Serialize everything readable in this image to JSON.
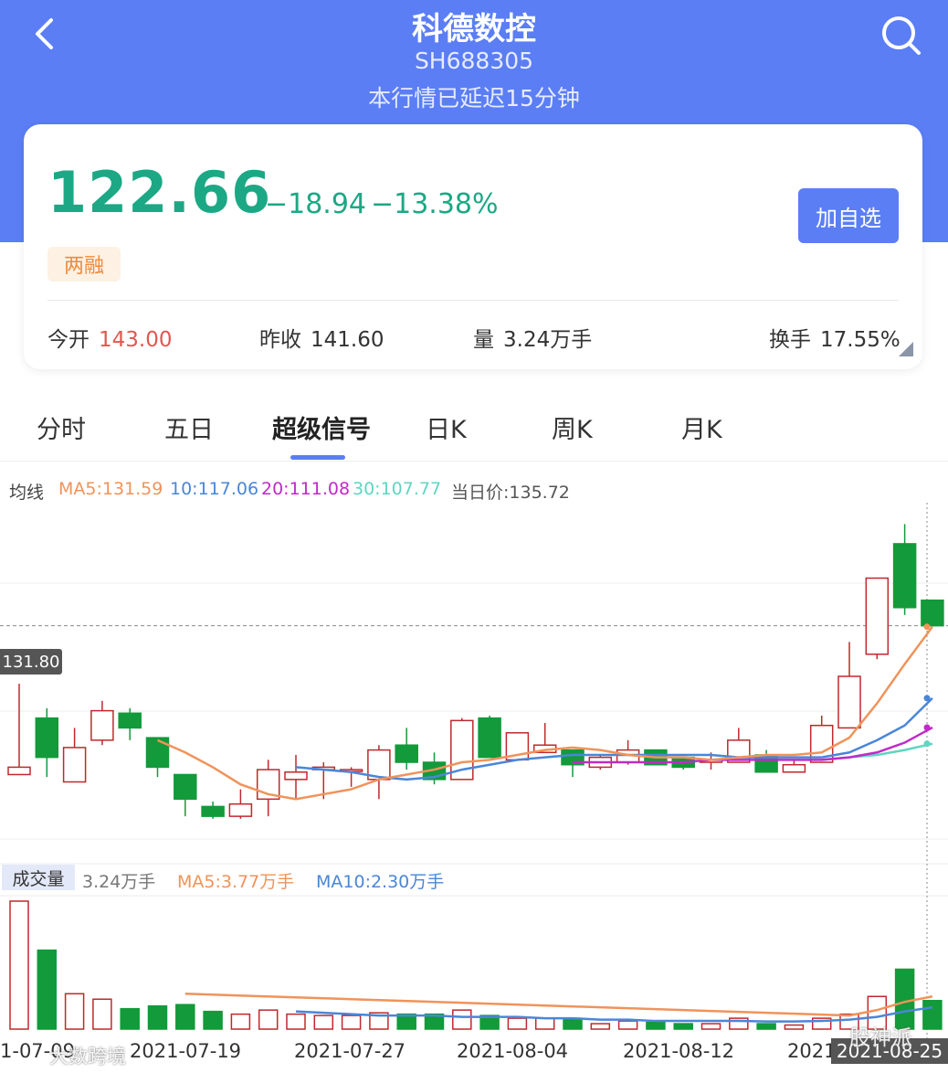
{
  "header": {
    "title": "科德数控",
    "code": "SH688305",
    "delay_notice": "本行情已延迟15分钟"
  },
  "quote": {
    "price": "122.66",
    "change": "−18.94",
    "change_pct": "−13.38%",
    "tag": "两融",
    "add_button": "加自选",
    "stats": [
      {
        "label": "今开",
        "value": "143.00"
      },
      {
        "label": "昨收",
        "value": "141.60"
      },
      {
        "label": "量",
        "value": "3.24万手"
      },
      {
        "label": "换手",
        "value": "17.55%"
      }
    ]
  },
  "tabs": [
    "分时",
    "五日",
    "超级信号",
    "日K",
    "周K",
    "月K"
  ],
  "active_tab": "超级信号",
  "ma_legend": {
    "label": "均线",
    "ma5": "MA5:131.59",
    "ma10": "10:117.06",
    "ma20": "20:111.08",
    "ma30": "30:107.77",
    "day_price": "当日价:135.72"
  },
  "price_marker": "131.80",
  "volume_legend": {
    "label": "成交量",
    "vol": "3.24万手",
    "ma5": "MA5:3.77万手",
    "ma10": "MA10:2.30万手"
  },
  "dates": [
    "1-07-09",
    "2021-07-19",
    "2021-07-27",
    "2021-08-04",
    "2021-08-12",
    "2021",
    "2021-08-25"
  ],
  "watermarks": [
    "大数跨境",
    "股神派"
  ],
  "colors": {
    "brand": "#5b7ef5",
    "down": "#1ca884",
    "up": "#c0282d",
    "ma5": "#f0935a",
    "ma10": "#4a86d8",
    "ma20": "#c02ac8",
    "ma30": "#5fd6c0"
  },
  "chart_data": {
    "type": "candlestick",
    "candles": [
      {
        "o": 101.5,
        "c": 103.0,
        "h": 120.0,
        "l": 101.5
      },
      {
        "o": 113.0,
        "c": 105.0,
        "h": 115.0,
        "l": 101.0
      },
      {
        "o": 100.0,
        "c": 107.0,
        "h": 111.0,
        "l": 100.0
      },
      {
        "o": 108.5,
        "c": 114.5,
        "h": 116.5,
        "l": 107.5
      },
      {
        "o": 114.0,
        "c": 111.0,
        "h": 115.0,
        "l": 108.5
      },
      {
        "o": 109.0,
        "c": 103.0,
        "h": 109.0,
        "l": 101.0
      },
      {
        "o": 101.5,
        "c": 96.5,
        "h": 101.5,
        "l": 93.0
      },
      {
        "o": 95.0,
        "c": 93.0,
        "h": 96.0,
        "l": 92.5
      },
      {
        "o": 93.0,
        "c": 95.5,
        "h": 98.5,
        "l": 92.5
      },
      {
        "o": 96.5,
        "c": 102.5,
        "h": 104.5,
        "l": 93.0
      },
      {
        "o": 100.5,
        "c": 102.0,
        "h": 105.5,
        "l": 96.5
      },
      {
        "o": 102.5,
        "c": 103.0,
        "h": 104.0,
        "l": 96.5
      },
      {
        "o": 102.5,
        "c": 102.5,
        "h": 103.0,
        "l": 99.0
      },
      {
        "o": 100.5,
        "c": 106.5,
        "h": 107.5,
        "l": 96.5
      },
      {
        "o": 107.5,
        "c": 104.0,
        "h": 111.0,
        "l": 102.5
      },
      {
        "o": 104.0,
        "c": 100.5,
        "h": 106.0,
        "l": 99.5
      },
      {
        "o": 100.5,
        "c": 112.5,
        "h": 113.0,
        "l": 100.5
      },
      {
        "o": 113.0,
        "c": 105.0,
        "h": 113.5,
        "l": 105.0
      },
      {
        "o": 104.5,
        "c": 110.0,
        "h": 110.0,
        "l": 104.5
      },
      {
        "o": 106.0,
        "c": 107.5,
        "h": 112.0,
        "l": 106.0
      },
      {
        "o": 106.5,
        "c": 103.5,
        "h": 106.5,
        "l": 101.0
      },
      {
        "o": 103.0,
        "c": 105.0,
        "h": 105.5,
        "l": 102.5
      },
      {
        "o": 104.0,
        "c": 106.5,
        "h": 108.5,
        "l": 103.5
      },
      {
        "o": 106.5,
        "c": 103.5,
        "h": 106.5,
        "l": 103.5
      },
      {
        "o": 105.0,
        "c": 103.0,
        "h": 105.0,
        "l": 102.5
      },
      {
        "o": 104.0,
        "c": 104.5,
        "h": 106.0,
        "l": 102.5
      },
      {
        "o": 104.0,
        "c": 108.5,
        "h": 111.0,
        "l": 104.0
      },
      {
        "o": 105.5,
        "c": 102.0,
        "h": 106.5,
        "l": 102.0
      },
      {
        "o": 102.0,
        "c": 103.5,
        "h": 104.5,
        "l": 102.0
      },
      {
        "o": 104.0,
        "c": 111.5,
        "h": 113.5,
        "l": 104.0
      },
      {
        "o": 111.0,
        "c": 121.5,
        "h": 128.5,
        "l": 111.0
      },
      {
        "o": 126.0,
        "c": 141.5,
        "h": 141.5,
        "l": 125.0
      },
      {
        "o": 148.5,
        "c": 135.5,
        "h": 152.5,
        "l": 134.0
      },
      {
        "o": 137.0,
        "c": 131.8,
        "h": 137.0,
        "l": 131.8
      }
    ],
    "ma5": [
      null,
      null,
      null,
      null,
      null,
      108.5,
      106.0,
      103.0,
      99.5,
      97.5,
      96.5,
      97.5,
      98.5,
      100.5,
      101.5,
      102.5,
      104.0,
      104.5,
      105.5,
      106.5,
      107.0,
      106.5,
      105.5,
      105.0,
      105.0,
      104.5,
      105.0,
      105.5,
      105.5,
      106.0,
      109.0,
      116.0,
      124.0,
      131.59
    ],
    "ma10": [
      null,
      null,
      null,
      null,
      null,
      null,
      null,
      null,
      null,
      null,
      103.0,
      102.5,
      102.0,
      101.0,
      100.5,
      101.0,
      102.5,
      103.5,
      104.5,
      105.0,
      105.5,
      105.5,
      105.5,
      105.5,
      105.5,
      105.5,
      105.0,
      105.0,
      105.0,
      105.0,
      106.0,
      108.5,
      111.5,
      117.06
    ],
    "ma20": [
      null,
      null,
      null,
      null,
      null,
      null,
      null,
      null,
      null,
      null,
      null,
      null,
      null,
      null,
      null,
      null,
      null,
      null,
      null,
      null,
      104.0,
      104.0,
      104.0,
      104.0,
      104.0,
      104.5,
      104.5,
      104.5,
      104.5,
      104.5,
      105.0,
      106.0,
      108.0,
      111.08
    ],
    "ma30": [
      null,
      null,
      null,
      null,
      null,
      null,
      null,
      null,
      null,
      null,
      null,
      null,
      null,
      null,
      null,
      null,
      null,
      null,
      null,
      null,
      null,
      null,
      null,
      null,
      null,
      null,
      null,
      null,
      null,
      104.5,
      105.0,
      105.5,
      106.5,
      107.77
    ],
    "volume": [
      4.7,
      2.9,
      1.3,
      1.1,
      0.75,
      0.85,
      0.9,
      0.65,
      0.55,
      0.7,
      0.55,
      0.5,
      0.5,
      0.6,
      0.55,
      0.55,
      0.7,
      0.5,
      0.4,
      0.4,
      0.35,
      0.2,
      0.3,
      0.25,
      0.2,
      0.2,
      0.4,
      0.2,
      0.15,
      0.4,
      0.55,
      1.2,
      2.2,
      1.05
    ],
    "vol_ma5": [
      null,
      null,
      null,
      null,
      null,
      null,
      1.3,
      null,
      null,
      null,
      null,
      null,
      null,
      null,
      null,
      null,
      null,
      null,
      null,
      null,
      null,
      null,
      null,
      null,
      null,
      null,
      null,
      null,
      null,
      null,
      0.5,
      0.7,
      1.0,
      1.2
    ],
    "vol_ma10": [
      null,
      null,
      null,
      null,
      null,
      null,
      null,
      null,
      null,
      null,
      0.65,
      0.6,
      0.55,
      0.5,
      0.5,
      0.5,
      0.45,
      0.45,
      0.45,
      0.4,
      0.4,
      0.35,
      0.35,
      0.3,
      0.3,
      0.3,
      0.3,
      0.28,
      0.28,
      0.3,
      0.35,
      0.45,
      0.65,
      0.8
    ],
    "ylim": [
      88,
      155
    ],
    "vol_ylim": [
      0,
      4.9
    ]
  }
}
